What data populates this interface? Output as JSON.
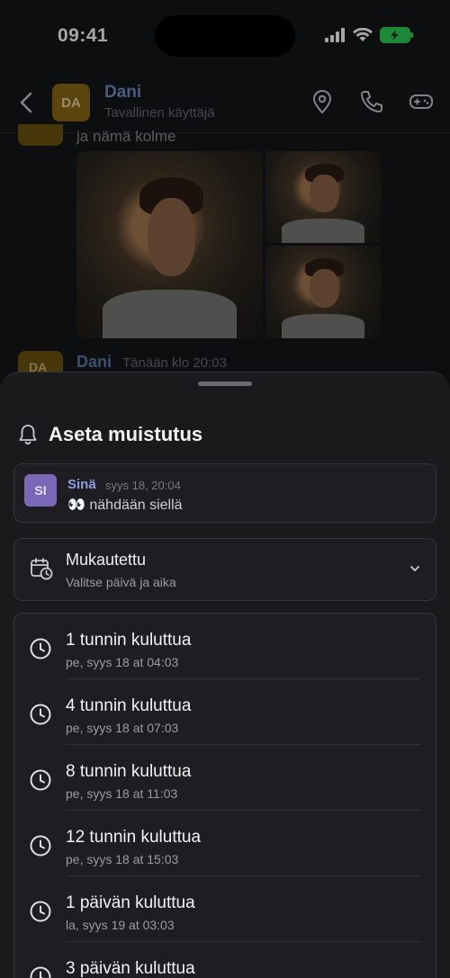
{
  "status_bar": {
    "time": "09:41"
  },
  "chat_header": {
    "avatar_initials": "DA",
    "contact_name": "Dani",
    "contact_role": "Tavallinen käyttäjä",
    "icons": [
      "back-icon",
      "location-pin-icon",
      "phone-icon",
      "gamepad-icon"
    ]
  },
  "chat": {
    "message_text": "ja nämä kolme",
    "photo_count": 3,
    "next_message": {
      "avatar_initials": "DA",
      "author": "Dani",
      "time": "Tänään klo 20:03"
    }
  },
  "sheet": {
    "title": "Aseta muistutus",
    "title_icon": "bell-icon",
    "preview": {
      "avatar_initials": "SI",
      "author": "Sinä",
      "time": "syys 18, 20:04",
      "text": "👀 nähdään siellä"
    },
    "custom": {
      "label": "Mukautettu",
      "sub": "Valitse päivä ja aika",
      "icon": "calendar-clock-icon"
    },
    "options": [
      {
        "label": "1 tunnin kuluttua",
        "sub": "pe, syys 18 at 04:03"
      },
      {
        "label": "4 tunnin kuluttua",
        "sub": "pe, syys 18 at 07:03"
      },
      {
        "label": "8 tunnin kuluttua",
        "sub": "pe, syys 18 at 11:03"
      },
      {
        "label": "12 tunnin kuluttua",
        "sub": "pe, syys 18 at 15:03"
      },
      {
        "label": "1 päivän kuluttua",
        "sub": "la, syys 19 at 03:03"
      },
      {
        "label": "3 päivän kuluttua",
        "sub": ""
      }
    ]
  },
  "colors": {
    "accent_name": "#6f8fc7",
    "da_avatar": "#8c6a14",
    "si_avatar": "#7a68b6",
    "battery": "#2fd158",
    "sheet_bg": "#1a1a1d"
  }
}
